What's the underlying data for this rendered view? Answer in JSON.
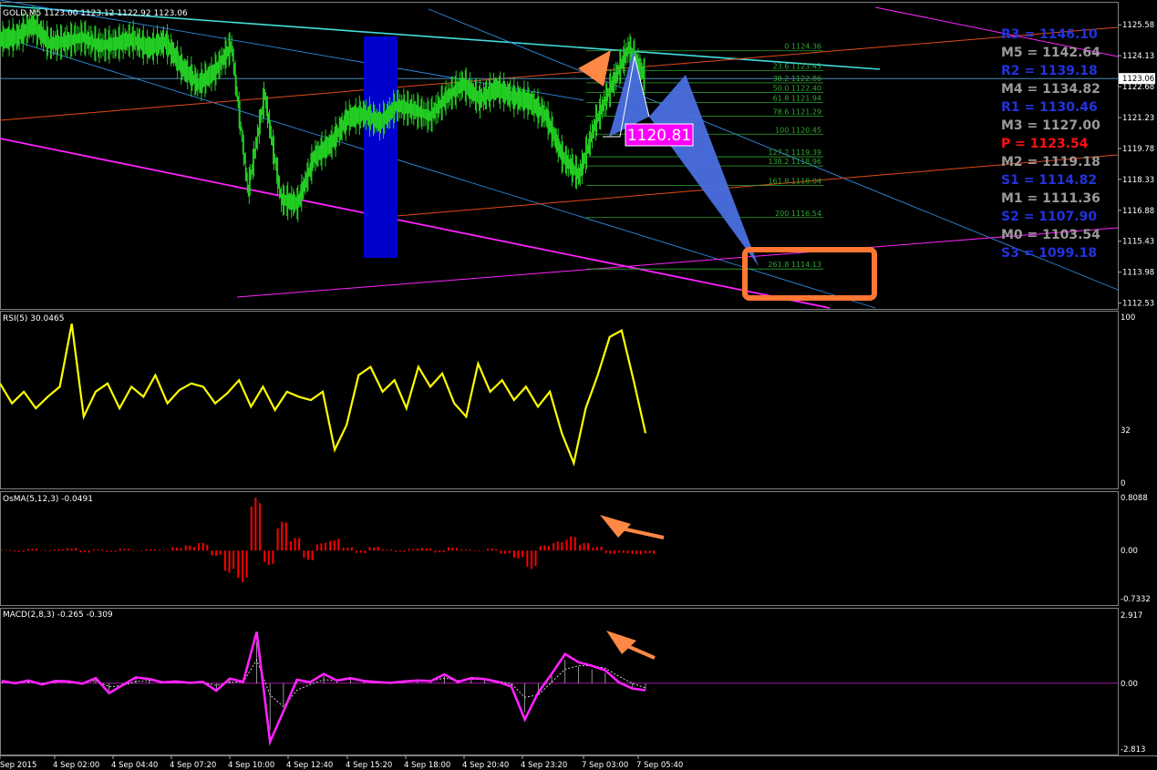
{
  "price_panel": {
    "header": "GOLD,M5  1123.00 1123.12 1122.92 1123.06",
    "current_price": "1123.06",
    "y_ticks": [
      "1125.58",
      "1124.13",
      "1122.68",
      "1121.23",
      "1119.78",
      "1118.33",
      "1116.88",
      "1115.43",
      "1113.98",
      "1112.53"
    ],
    "y_tick_values": [
      1125.58,
      1124.13,
      1122.68,
      1121.23,
      1119.78,
      1118.33,
      1116.88,
      1115.43,
      1113.98,
      1112.53
    ],
    "fib_levels": [
      {
        "label": "0 1124.36",
        "price": 1124.36
      },
      {
        "label": "23.6 1123.43",
        "price": 1123.43
      },
      {
        "label": "38.2 1122.86",
        "price": 1122.86
      },
      {
        "label": "50.0 1122.40",
        "price": 1122.4
      },
      {
        "label": "61.8 1121.94",
        "price": 1121.94
      },
      {
        "label": "78.6 1121.29",
        "price": 1121.29
      },
      {
        "label": "100 1120.45",
        "price": 1120.45
      },
      {
        "label": "127.2 1119.39",
        "price": 1119.39
      },
      {
        "label": "138.2 1118.96",
        "price": 1118.96
      },
      {
        "label": "161.8 1118.04",
        "price": 1118.04
      },
      {
        "label": "200 1116.54",
        "price": 1116.54
      },
      {
        "label": "261.8 1114.13",
        "price": 1114.13
      }
    ],
    "pattern_label": "1120.81",
    "pivot_levels": [
      {
        "label": "R3 = 1146.10",
        "color": "#2233dd"
      },
      {
        "label": "M5 = 1142.64",
        "color": "#9a9a9a"
      },
      {
        "label": "R2 = 1139.18",
        "color": "#2233dd"
      },
      {
        "label": "M4 = 1134.82",
        "color": "#9a9a9a"
      },
      {
        "label": "R1 = 1130.46",
        "color": "#2233dd"
      },
      {
        "label": "M3 = 1127.00",
        "color": "#9a9a9a"
      },
      {
        "label": "P  = 1123.54",
        "color": "#ff1111"
      },
      {
        "label": "M2 = 1119.18",
        "color": "#9a9a9a"
      },
      {
        "label": "S1 = 1114.82",
        "color": "#2233dd"
      },
      {
        "label": "M1 = 1111.36",
        "color": "#9a9a9a"
      },
      {
        "label": "S2 = 1107.90",
        "color": "#2233dd"
      },
      {
        "label": "M0 = 1103.54",
        "color": "#9a9a9a"
      },
      {
        "label": "S3 = 1099.18",
        "color": "#2233dd"
      }
    ]
  },
  "rsi_panel": {
    "header": "RSI(5) 30.0465",
    "y_ticks": [
      "100",
      "32",
      "0"
    ],
    "y_tick_values": [
      100,
      32,
      0
    ]
  },
  "osma_panel": {
    "header": "OsMA(5,12,3) -0.0491",
    "y_ticks": [
      "0.8088",
      "0.00",
      "-0.7332"
    ],
    "y_tick_values": [
      0.8088,
      0,
      -0.7332
    ]
  },
  "macd_panel": {
    "header": "MACD(2,8,3) -0.265 -0.309",
    "y_ticks": [
      "2.917",
      "0.00",
      "-2.813"
    ],
    "y_tick_values": [
      2.917,
      0,
      -2.813
    ]
  },
  "x_axis_labels": [
    "Sep 2015",
    "4 Sep 02:00",
    "4 Sep 04:40",
    "4 Sep 07:20",
    "4 Sep 10:00",
    "4 Sep 12:40",
    "4 Sep 15:20",
    "4 Sep 18:00",
    "4 Sep 20:40",
    "4 Sep 23:20",
    "7 Sep 03:00",
    "7 Sep 05:40"
  ],
  "colors": {
    "candles": "#22cc22",
    "rsi": "#ffff00",
    "osma": "#ff0000",
    "macd": "#ff22ff",
    "highlight_bar": "#0000cc",
    "pattern": "#4a6fe0",
    "arrows": "#ff8844",
    "target_box": "#ff7733",
    "fib": "#2ea82e",
    "trend_cyan": "#44dddd",
    "trend_blue": "#2e8bdf",
    "trend_magenta": "#ff22ff",
    "trend_orange": "#e04a1a"
  },
  "chart_data": [
    {
      "type": "line",
      "title": "GOLD,M5",
      "series": [
        {
          "values": [
            1124.9,
            1125.0,
            1125.6,
            1124.7,
            1124.8,
            1125.0,
            1124.6,
            1124.7,
            1124.9,
            1124.5,
            1124.8,
            1123.6,
            1122.8,
            1123.4,
            1124.6,
            1117.8,
            1122.3,
            1117.4,
            1117.2,
            1119.4,
            1120.0,
            1121.2,
            1121.4,
            1121.0,
            1121.8,
            1121.6,
            1121.3,
            1122.2,
            1122.8,
            1122.1,
            1122.6,
            1122.2,
            1122.0,
            1121.3,
            1119.4,
            1118.5,
            1121.0,
            1122.8,
            1124.5,
            1123.1
          ]
        }
      ]
    },
    {
      "type": "line",
      "title": "RSI(5)",
      "ylim": [
        0,
        100
      ],
      "series": [
        {
          "name": "RSI(5)",
          "values": [
            60,
            48,
            55,
            45,
            52,
            58,
            96,
            40,
            55,
            60,
            45,
            58,
            52,
            65,
            48,
            56,
            60,
            58,
            48,
            54,
            62,
            46,
            58,
            44,
            55,
            52,
            50,
            55,
            20,
            35,
            65,
            70,
            55,
            62,
            45,
            70,
            58,
            66,
            48,
            40,
            72,
            55,
            62,
            50,
            58,
            46,
            55,
            30,
            12,
            45,
            65,
            88,
            92,
            62,
            30
          ]
        }
      ]
    },
    {
      "type": "bar",
      "title": "OsMA(5,12,3)",
      "ylim": [
        -0.7332,
        0.8088
      ],
      "series": [
        {
          "name": "OsMA(5,12,3)",
          "values": [
            0.01,
            -0.02,
            0.03,
            -0.01,
            0.02,
            0.04,
            -0.03,
            0.02,
            -0.02,
            0.03,
            -0.01,
            0.02,
            0.01,
            0.05,
            0.08,
            0.12,
            -0.08,
            -0.34,
            -0.48,
            0.81,
            -0.22,
            0.45,
            0.2,
            -0.15,
            0.12,
            0.18,
            0.05,
            -0.04,
            0.06,
            0.02,
            -0.02,
            0.03,
            0.04,
            -0.03,
            0.05,
            0.02,
            -0.01,
            0.03,
            -0.05,
            -0.12,
            -0.28,
            0.08,
            0.14,
            0.22,
            0.12,
            0.06,
            -0.05,
            -0.04,
            -0.06,
            -0.05
          ]
        }
      ]
    },
    {
      "type": "line",
      "title": "MACD(2,8,3)",
      "ylim": [
        -2.813,
        2.917
      ],
      "series": [
        {
          "name": "MACD(2,8,3)",
          "values": [
            0.1,
            0.0,
            0.12,
            -0.05,
            0.1,
            0.08,
            -0.02,
            0.22,
            -0.42,
            -0.08,
            0.25,
            0.18,
            0.04,
            0.08,
            0.02,
            0.06,
            -0.32,
            0.2,
            0.06,
            2.2,
            -2.5,
            -1.2,
            0.15,
            0.05,
            0.4,
            0.12,
            0.22,
            0.1,
            0.05,
            0.02,
            0.08,
            0.12,
            0.1,
            0.38,
            0.06,
            0.22,
            0.18,
            0.06,
            -0.14,
            -1.55,
            -0.4,
            0.4,
            1.25,
            0.9,
            0.75,
            0.55,
            0.05,
            -0.22,
            -0.3
          ]
        },
        {
          "name": "Signal",
          "values": [
            0.05,
            0.03,
            0.06,
            0.01,
            0.05,
            0.06,
            0.02,
            0.12,
            -0.15,
            -0.1,
            0.08,
            0.12,
            0.07,
            0.07,
            0.04,
            0.05,
            -0.1,
            0.05,
            0.05,
            1.0,
            -0.5,
            -1.0,
            -0.3,
            -0.05,
            0.15,
            0.13,
            0.17,
            0.13,
            0.08,
            0.05,
            0.06,
            0.09,
            0.1,
            0.22,
            0.12,
            0.17,
            0.17,
            0.1,
            -0.02,
            -0.6,
            -0.5,
            0.05,
            0.6,
            0.75,
            0.75,
            0.65,
            0.3,
            0.0,
            -0.2
          ]
        }
      ]
    }
  ]
}
